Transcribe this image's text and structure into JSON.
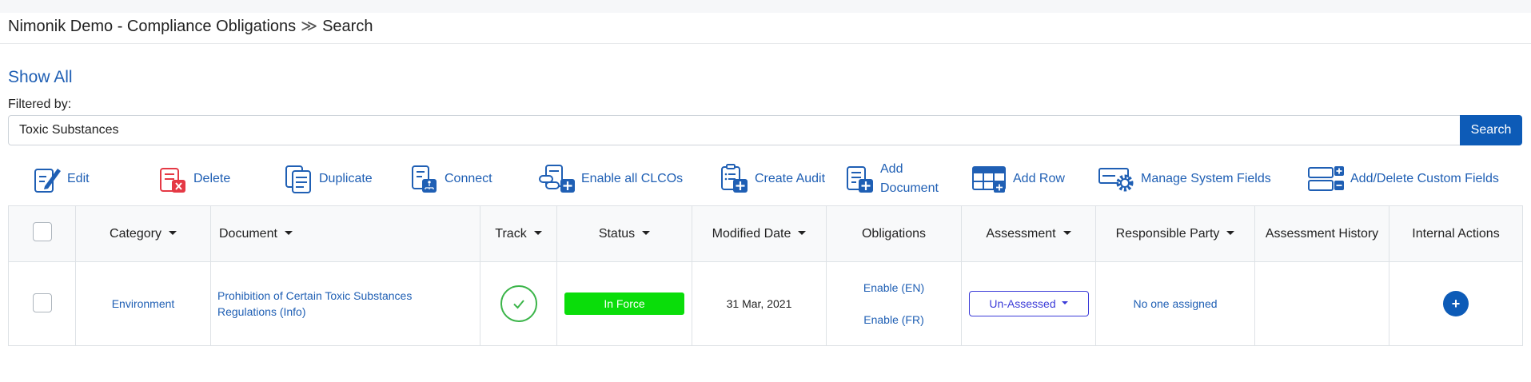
{
  "header": {
    "app_title": "Nimonik Demo - Compliance Obligations",
    "separator": "≫",
    "page": "Search"
  },
  "filter": {
    "show_all": "Show All",
    "filtered_by_label": "Filtered by:",
    "search_value": "Toxic Substances",
    "search_button": "Search"
  },
  "toolbar": {
    "edit": "Edit",
    "delete": "Delete",
    "duplicate": "Duplicate",
    "connect": "Connect",
    "enable_all": "Enable all CLCOs",
    "create_audit": "Create Audit",
    "add_document_1": "Add",
    "add_document_2": "Document",
    "add_row": "Add Row",
    "manage_system_fields": "Manage System Fields",
    "add_delete_custom_fields": "Add/Delete Custom Fields"
  },
  "table": {
    "columns": [
      "Category",
      "Document",
      "Track",
      "Status",
      "Modified Date",
      "Obligations",
      "Assessment",
      "Responsible Party",
      "Assessment History",
      "Internal Actions"
    ],
    "rows": [
      {
        "category": "Environment",
        "document": "Prohibition of Certain Toxic Substances Regulations (Info)",
        "status": "In Force",
        "modified_date": "31 Mar, 2021",
        "obligations_en": "Enable (EN)",
        "obligations_fr": "Enable (FR)",
        "assessment": "Un-Assessed",
        "responsible_party": "No one assigned",
        "assessment_history": "",
        "internal_actions": "+"
      }
    ]
  },
  "colors": {
    "link": "#1f5fb4",
    "primary": "#0d5bb7",
    "status_green": "#0add0a",
    "track_green": "#3cb54a",
    "delete_red": "#e53945",
    "assessment_border": "#3b3bd8"
  },
  "icons": [
    "edit-icon",
    "delete-icon",
    "duplicate-icon",
    "connect-icon",
    "enable-all-icon",
    "create-audit-icon",
    "add-document-icon",
    "add-row-icon",
    "manage-fields-icon",
    "custom-fields-icon",
    "checkmark-icon",
    "plus-icon"
  ]
}
